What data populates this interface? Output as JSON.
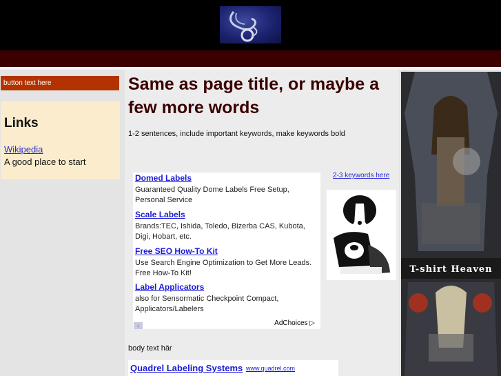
{
  "header": {
    "logo_icon": "stethoscope-logo"
  },
  "sidebar": {
    "button_label": "button text here",
    "links_heading": "Links",
    "links": [
      {
        "label": "Wikipedia",
        "description": "A good place to start"
      }
    ]
  },
  "main": {
    "title": "Same as page title, or maybe a few more words",
    "intro": "1-2 sentences, include important keywords, make keywords bold",
    "ads": [
      {
        "title": "Domed Labels",
        "desc": "Guaranteed Quality Dome Labels Free Setup, Personal Service"
      },
      {
        "title": "Scale Labels",
        "desc": "Brands:TEC, Ishida, Toledo, Bizerba CAS, Kubota, Digi, Hobart, etc."
      },
      {
        "title": "Free SEO How-To Kit",
        "desc": "Use Search Engine Optimization to Get More Leads. Free How-To Kit!"
      },
      {
        "title": "Label Applicators",
        "desc": "also for Sensormatic Checkpoint Compact, Applicators/Labelers"
      }
    ],
    "ad_choices": "AdChoices",
    "keywords_link": "2-3 keywords here",
    "body_text": "body text här",
    "sponsor": {
      "title": "Quadrel Labeling Systems",
      "url": "www.quadrel.com"
    }
  },
  "right_ad": {
    "caption": "T-shirt Heaven"
  },
  "colors": {
    "header": "#000000",
    "nav_bar": "#3a0000",
    "button": "#b33300",
    "title": "#3a0000",
    "link": "#1a1ad6"
  }
}
